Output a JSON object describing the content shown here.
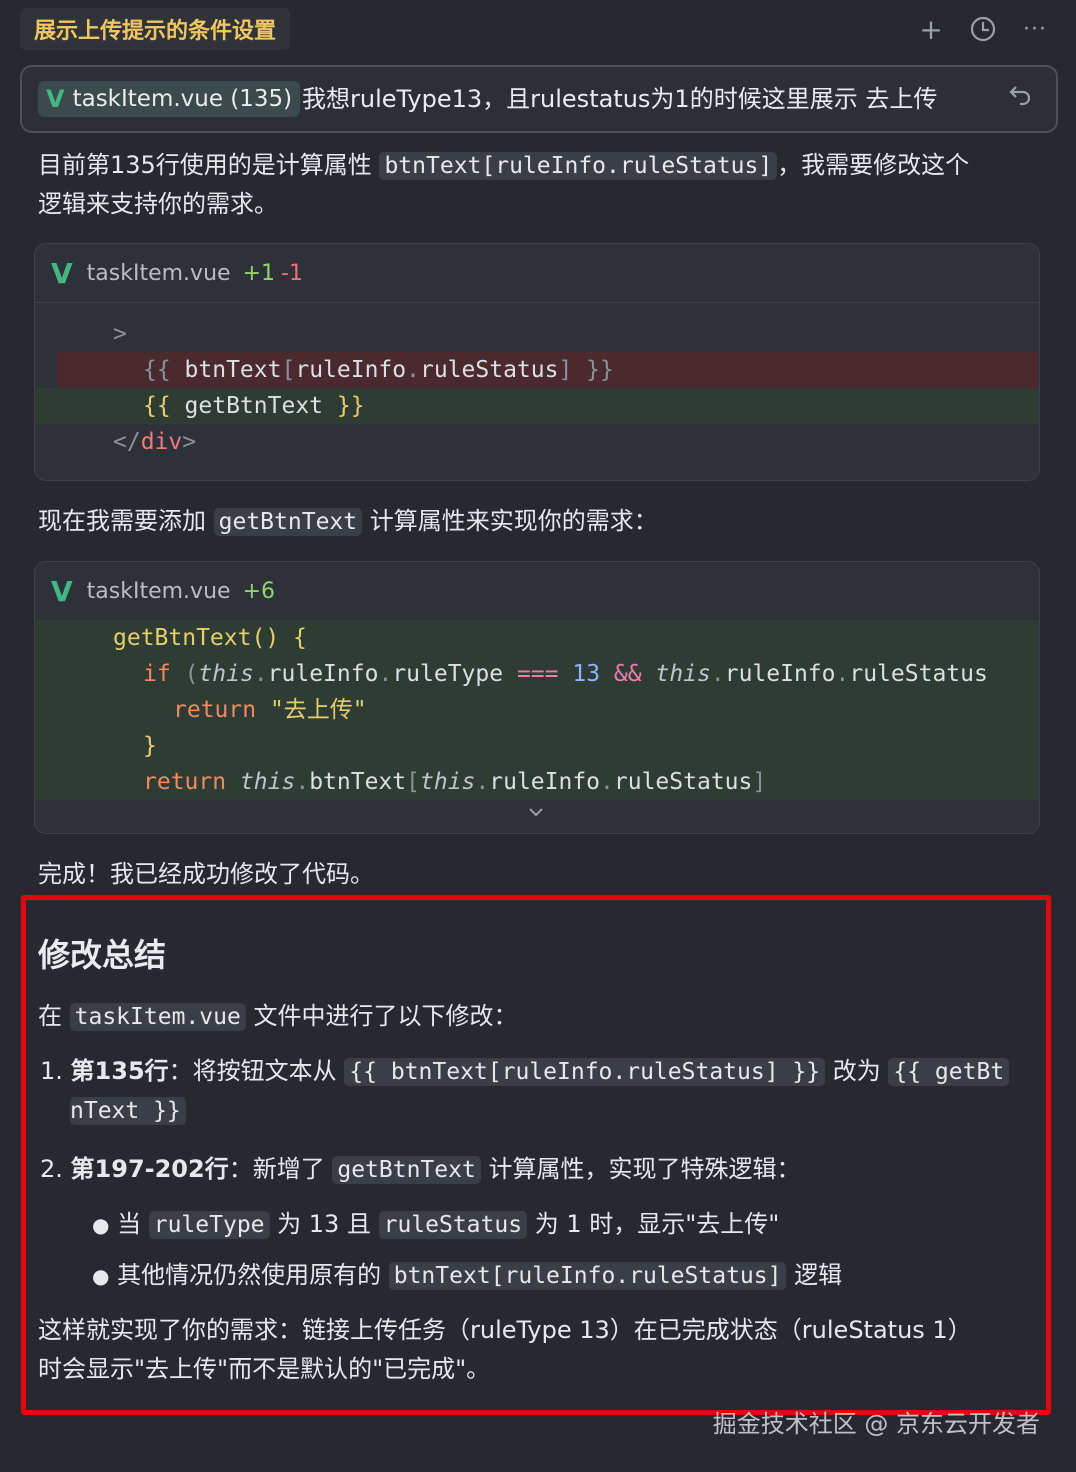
{
  "header": {
    "title": "展示上传提示的条件设置",
    "icons": [
      "plus-icon",
      "history-clock-icon",
      "more-ellipsis-icon"
    ]
  },
  "prompt": {
    "chip_label": "taskItem.vue (135)",
    "text": "我想ruleType13，且rulestatus为1的时候这里展示 去上传"
  },
  "intro": {
    "before": "目前第135行使用的是计算属性",
    "code": "btnText[ruleInfo.ruleStatus]",
    "after": "，我需要修改这个",
    "line2": "逻辑来支持你的需求。"
  },
  "diff1": {
    "file": "taskItem.vue",
    "added": "+1",
    "removed": "-1",
    "lines": [
      ">",
      "{{ btnText[ruleInfo.ruleStatus] }}",
      "{{ getBtnText }}",
      "</div>"
    ]
  },
  "mid": {
    "before": "现在我需要添加",
    "code": "getBtnText",
    "after": "计算属性来实现你的需求："
  },
  "diff2": {
    "file": "taskItem.vue",
    "added": "+6"
  },
  "done_text": "完成！我已经成功修改了代码。",
  "summary": {
    "heading": "修改总结",
    "intro_before": "在",
    "intro_code": "taskItem.vue",
    "intro_after": "文件中进行了以下修改：",
    "item1": {
      "num": "1.",
      "bold": "第135行",
      "text": "：将按钮文本从",
      "code1": "{{ btnText[ruleInfo.ruleStatus] }}",
      "mid": "改为",
      "code2a": "{{ getBt",
      "code2b": "nText }}"
    },
    "item2": {
      "num": "2.",
      "bold": "第197-202行",
      "text": "：新增了",
      "code": "getBtnText",
      "after": "计算属性，实现了特殊逻辑："
    },
    "bullet1": {
      "a": "当",
      "code1": "ruleType",
      "b": "为 13 且",
      "code2": "ruleStatus",
      "c": "为 1 时，显示\"去上传\""
    },
    "bullet2": {
      "a": "其他情况仍然使用原有的",
      "code": "btnText[ruleInfo.ruleStatus]",
      "b": "逻辑"
    },
    "closing1": "这样就实现了你的需求：链接上传任务（ruleType 13）在已完成状态（ruleStatus 1）",
    "closing2": "时会显示\"去上传\"而不是默认的\"已完成\"。"
  },
  "watermark": "掘金技术社区 @ 京东云开发者",
  "colors": {
    "background": "#262a30",
    "title": "#f0c75e",
    "vue_green": "#41b883",
    "highlight_box": "#e8000f"
  }
}
